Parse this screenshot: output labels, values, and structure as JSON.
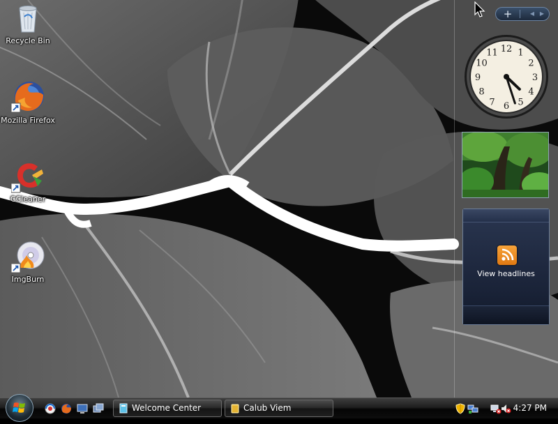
{
  "desktop_icons": [
    {
      "label": "Recycle Bin",
      "icon": "recycle-bin-icon"
    },
    {
      "label": "Mozilla Firefox",
      "icon": "firefox-icon"
    },
    {
      "label": "CCleaner",
      "icon": "ccleaner-icon"
    },
    {
      "label": "ImgBurn",
      "icon": "imgburn-icon"
    }
  ],
  "sidebar": {
    "add_symbol": "+",
    "prev_symbol": "◀",
    "next_symbol": "▶",
    "clock": {
      "numerals": [
        "12",
        "1",
        "2",
        "3",
        "4",
        "5",
        "6",
        "7",
        "8",
        "9",
        "10",
        "11"
      ],
      "hour": 4,
      "minute": 27
    },
    "feed": {
      "headline": "View headlines"
    }
  },
  "taskbar": {
    "quick_launch": [
      "ie-icon",
      "firefox-icon",
      "show-desktop-icon",
      "switch-windows-icon"
    ],
    "buttons": [
      {
        "label": "Welcome Center",
        "icon": "welcome-center-icon"
      },
      {
        "label": "Calub Viem",
        "icon": "folder-icon"
      }
    ],
    "tray": {
      "icons": [
        "security-shield-icon",
        "network-icon",
        "network-alert-icon",
        "volume-muted-icon"
      ],
      "time": "4:27 PM"
    }
  },
  "colors": {
    "rss": "#f08a1c",
    "taskbar": "#1a1a1a",
    "accent": "#6c84a3"
  }
}
